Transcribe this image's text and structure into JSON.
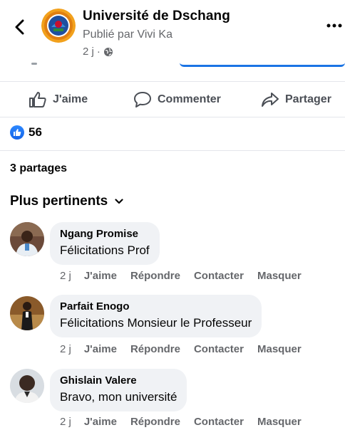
{
  "header": {
    "page_name": "Université de Dschang",
    "published_by": "Publié par Vivi Ka",
    "time": "2 j",
    "separator": "·"
  },
  "actions": {
    "like_label": "J'aime",
    "comment_label": "Commenter",
    "share_label": "Partager"
  },
  "reactions": {
    "count": "56"
  },
  "shares": {
    "label": "3 partages"
  },
  "sort": {
    "label": "Plus pertinents"
  },
  "comments": [
    {
      "author": "Ngang Promise",
      "text": "Félicitations Prof",
      "time": "2 j",
      "like": "J'aime",
      "reply": "Répondre",
      "contact": "Contacter",
      "hide": "Masquer"
    },
    {
      "author": "Parfait Enogo",
      "text": "Félicitations Monsieur le Professeur",
      "time": "2 j",
      "like": "J'aime",
      "reply": "Répondre",
      "contact": "Contacter",
      "hide": "Masquer"
    },
    {
      "author": "Ghislain Valere",
      "text": "Bravo, mon université",
      "time": "2 j",
      "like": "J'aime",
      "reply": "Répondre",
      "contact": "Contacter",
      "hide": "Masquer"
    }
  ],
  "colors": {
    "accent": "#1b74e4",
    "secondary_text": "#65676b",
    "bubble": "#f0f2f5"
  },
  "icons": [
    "back-arrow-icon",
    "globe-icon",
    "more-options-icon",
    "thumbs-up-icon",
    "comment-icon",
    "share-icon",
    "like-reaction-icon",
    "chevron-down-icon"
  ]
}
